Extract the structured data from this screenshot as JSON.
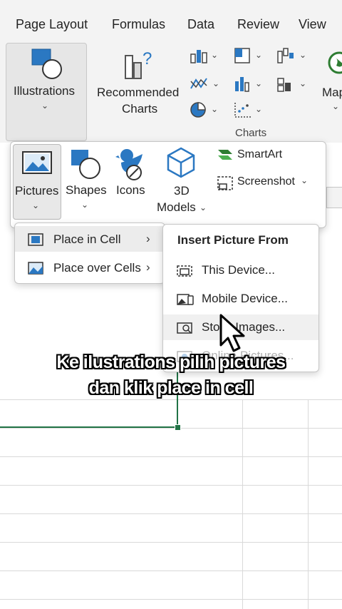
{
  "ribbon_tabs": [
    "Page Layout",
    "Formulas",
    "Data",
    "Review",
    "View"
  ],
  "ribbon": {
    "illustrations_label": "Illustrations",
    "recommended_charts_line1": "Recommended",
    "recommended_charts_line2": "Charts",
    "charts_group_label": "Charts",
    "maps_label": "Map"
  },
  "illustrations_panel": {
    "pictures_label": "Pictures",
    "shapes_label": "Shapes",
    "icons_label": "Icons",
    "models_line1": "3D",
    "models_line2": "Models",
    "smartart_label": "SmartArt",
    "screenshot_label": "Screenshot"
  },
  "pictures_menu": {
    "items": [
      {
        "label": "Place in Cell"
      },
      {
        "label": "Place over Cells"
      }
    ]
  },
  "insert_from_menu": {
    "title": "Insert Picture From",
    "items": [
      {
        "label": "This Device..."
      },
      {
        "label": "Mobile Device..."
      },
      {
        "label": "Stock Images..."
      },
      {
        "label": "Online Pictures..."
      }
    ]
  },
  "caption": {
    "line1": "Ke ilustrations pilih pictures",
    "line2": "dan klik place in cell"
  },
  "colors": {
    "excel_green": "#217346",
    "accent_blue": "#2b78c2",
    "ribbon_bg": "#f3f3f3"
  }
}
